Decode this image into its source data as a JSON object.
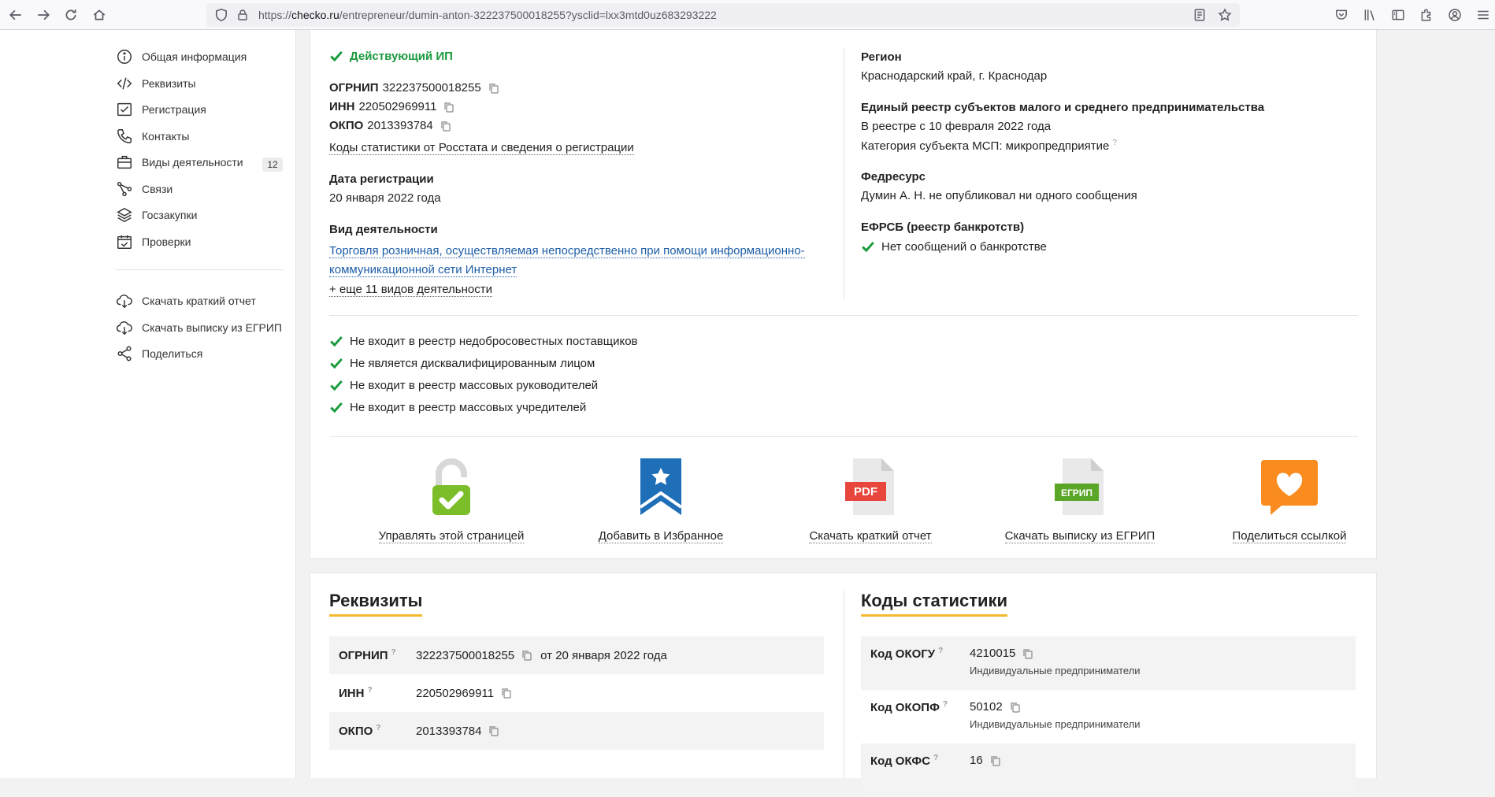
{
  "browser": {
    "url_prefix": "https://",
    "url_host": "checko.ru",
    "url_path": "/entrepreneur/dumin-anton-322237500018255?ysclid=lxx3mtd0uz683293222"
  },
  "sidebar": {
    "items": [
      {
        "label": "Общая информация",
        "icon": "info-icon"
      },
      {
        "label": "Реквизиты",
        "icon": "code-icon"
      },
      {
        "label": "Регистрация",
        "icon": "check-box-icon"
      },
      {
        "label": "Контакты",
        "icon": "phone-icon"
      },
      {
        "label": "Виды деятельности",
        "icon": "briefcase-icon",
        "badge": "12"
      },
      {
        "label": "Связи",
        "icon": "connections-icon"
      },
      {
        "label": "Госзакупки",
        "icon": "layers-icon"
      },
      {
        "label": "Проверки",
        "icon": "calendar-check-icon"
      }
    ],
    "actions": [
      {
        "label": "Скачать краткий отчет",
        "icon": "cloud-download-icon"
      },
      {
        "label": "Скачать выписку из ЕГРИП",
        "icon": "cloud-download-icon"
      },
      {
        "label": "Поделиться",
        "icon": "share-icon"
      }
    ]
  },
  "summary": {
    "status": "Действующий ИП",
    "ogrnip_label": "ОГРНИП",
    "ogrnip": "322237500018255",
    "inn_label": "ИНН",
    "inn": "220502969911",
    "okpo_label": "ОКПО",
    "okpo": "2013393784",
    "stat_link": "Коды статистики от Росстата и сведения о регистрации",
    "reg_date_label": "Дата регистрации",
    "reg_date": "20 января 2022 года",
    "activity_label": "Вид деятельности",
    "activity_line1": "Торговля розничная, осуществляемая непосредственно при помощи информационно-",
    "activity_line2": "коммуникационной сети Интернет",
    "more_activities": "+ еще 11 видов деятельности",
    "region_label": "Регион",
    "region": "Краснодарский край, г. Краснодар",
    "msp_label": "Единый реестр субъектов малого и среднего предпринимательства",
    "msp_since": "В реестре с 10 февраля 2022 года",
    "msp_category": "Категория субъекта МСП: микропредприятие",
    "fedresurs_label": "Федресурс",
    "fedresurs": "Думин А. Н. не опубликовал ни одного сообщения",
    "efrsb_label": "ЕФРСБ (реестр банкротств)",
    "efrsb": "Нет сообщений о банкротстве"
  },
  "checks": [
    "Не входит в реестр недобросовестных поставщиков",
    "Не является дисквалифицированным лицом",
    "Не входит в реестр массовых руководителей",
    "Не входит в реестр массовых учредителей"
  ],
  "actions": [
    {
      "label": "Управлять этой страницей",
      "icon": "unlock-check-icon"
    },
    {
      "label": "Добавить в Избранное",
      "icon": "bookmark-star-icon"
    },
    {
      "label": "Скачать краткий отчет",
      "icon": "pdf-file-icon",
      "badge": "PDF"
    },
    {
      "label": "Скачать выписку из ЕГРИП",
      "icon": "egrip-file-icon",
      "badge": "ЕГРИП"
    },
    {
      "label": "Поделиться ссылкой",
      "icon": "heart-chat-icon"
    }
  ],
  "rekvizity": {
    "title": "Реквизиты",
    "rows": [
      {
        "key": "ОГРНИП",
        "value": "322237500018255",
        "after": "от 20 января 2022 года"
      },
      {
        "key": "ИНН",
        "value": "220502969911",
        "after": ""
      },
      {
        "key": "ОКПО",
        "value": "2013393784",
        "after": ""
      }
    ]
  },
  "stat_codes": {
    "title": "Коды статистики",
    "rows": [
      {
        "key": "Код ОКОГУ",
        "value": "4210015",
        "desc": "Индивидуальные предприниматели"
      },
      {
        "key": "Код ОКОПФ",
        "value": "50102",
        "desc": "Индивидуальные предприниматели"
      },
      {
        "key": "Код ОКФС",
        "value": "16",
        "desc": ""
      }
    ]
  },
  "colors": {
    "accent_green": "#1a9a3e",
    "link_blue": "#1d5ea8",
    "underline_yellow": "#f5b82e"
  },
  "help_mark": "?"
}
